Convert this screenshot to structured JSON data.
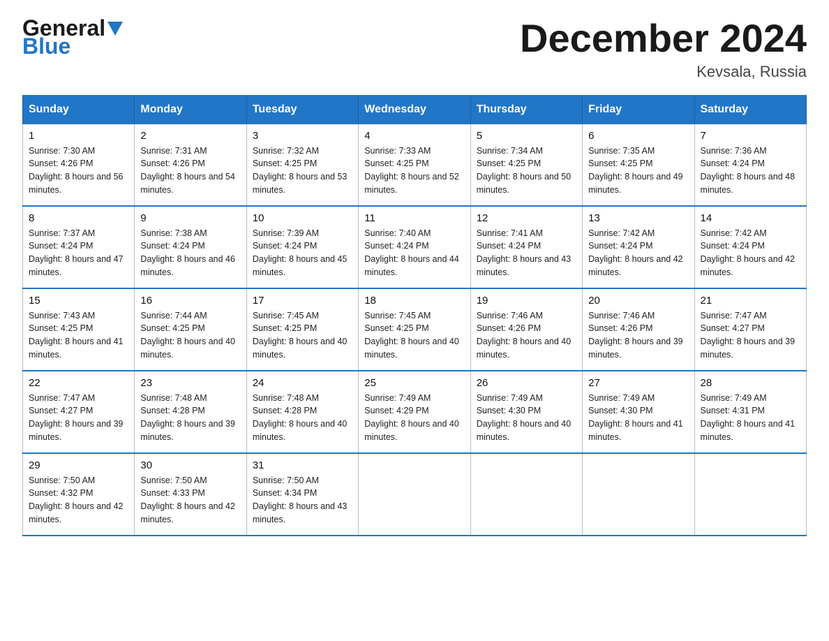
{
  "logo": {
    "line1": "General",
    "line2": "Blue"
  },
  "title": {
    "month_year": "December 2024",
    "location": "Kevsala, Russia"
  },
  "headers": [
    "Sunday",
    "Monday",
    "Tuesday",
    "Wednesday",
    "Thursday",
    "Friday",
    "Saturday"
  ],
  "weeks": [
    [
      {
        "day": "1",
        "sunrise": "7:30 AM",
        "sunset": "4:26 PM",
        "daylight": "8 hours and 56 minutes."
      },
      {
        "day": "2",
        "sunrise": "7:31 AM",
        "sunset": "4:26 PM",
        "daylight": "8 hours and 54 minutes."
      },
      {
        "day": "3",
        "sunrise": "7:32 AM",
        "sunset": "4:25 PM",
        "daylight": "8 hours and 53 minutes."
      },
      {
        "day": "4",
        "sunrise": "7:33 AM",
        "sunset": "4:25 PM",
        "daylight": "8 hours and 52 minutes."
      },
      {
        "day": "5",
        "sunrise": "7:34 AM",
        "sunset": "4:25 PM",
        "daylight": "8 hours and 50 minutes."
      },
      {
        "day": "6",
        "sunrise": "7:35 AM",
        "sunset": "4:25 PM",
        "daylight": "8 hours and 49 minutes."
      },
      {
        "day": "7",
        "sunrise": "7:36 AM",
        "sunset": "4:24 PM",
        "daylight": "8 hours and 48 minutes."
      }
    ],
    [
      {
        "day": "8",
        "sunrise": "7:37 AM",
        "sunset": "4:24 PM",
        "daylight": "8 hours and 47 minutes."
      },
      {
        "day": "9",
        "sunrise": "7:38 AM",
        "sunset": "4:24 PM",
        "daylight": "8 hours and 46 minutes."
      },
      {
        "day": "10",
        "sunrise": "7:39 AM",
        "sunset": "4:24 PM",
        "daylight": "8 hours and 45 minutes."
      },
      {
        "day": "11",
        "sunrise": "7:40 AM",
        "sunset": "4:24 PM",
        "daylight": "8 hours and 44 minutes."
      },
      {
        "day": "12",
        "sunrise": "7:41 AM",
        "sunset": "4:24 PM",
        "daylight": "8 hours and 43 minutes."
      },
      {
        "day": "13",
        "sunrise": "7:42 AM",
        "sunset": "4:24 PM",
        "daylight": "8 hours and 42 minutes."
      },
      {
        "day": "14",
        "sunrise": "7:42 AM",
        "sunset": "4:24 PM",
        "daylight": "8 hours and 42 minutes."
      }
    ],
    [
      {
        "day": "15",
        "sunrise": "7:43 AM",
        "sunset": "4:25 PM",
        "daylight": "8 hours and 41 minutes."
      },
      {
        "day": "16",
        "sunrise": "7:44 AM",
        "sunset": "4:25 PM",
        "daylight": "8 hours and 40 minutes."
      },
      {
        "day": "17",
        "sunrise": "7:45 AM",
        "sunset": "4:25 PM",
        "daylight": "8 hours and 40 minutes."
      },
      {
        "day": "18",
        "sunrise": "7:45 AM",
        "sunset": "4:25 PM",
        "daylight": "8 hours and 40 minutes."
      },
      {
        "day": "19",
        "sunrise": "7:46 AM",
        "sunset": "4:26 PM",
        "daylight": "8 hours and 40 minutes."
      },
      {
        "day": "20",
        "sunrise": "7:46 AM",
        "sunset": "4:26 PM",
        "daylight": "8 hours and 39 minutes."
      },
      {
        "day": "21",
        "sunrise": "7:47 AM",
        "sunset": "4:27 PM",
        "daylight": "8 hours and 39 minutes."
      }
    ],
    [
      {
        "day": "22",
        "sunrise": "7:47 AM",
        "sunset": "4:27 PM",
        "daylight": "8 hours and 39 minutes."
      },
      {
        "day": "23",
        "sunrise": "7:48 AM",
        "sunset": "4:28 PM",
        "daylight": "8 hours and 39 minutes."
      },
      {
        "day": "24",
        "sunrise": "7:48 AM",
        "sunset": "4:28 PM",
        "daylight": "8 hours and 40 minutes."
      },
      {
        "day": "25",
        "sunrise": "7:49 AM",
        "sunset": "4:29 PM",
        "daylight": "8 hours and 40 minutes."
      },
      {
        "day": "26",
        "sunrise": "7:49 AM",
        "sunset": "4:30 PM",
        "daylight": "8 hours and 40 minutes."
      },
      {
        "day": "27",
        "sunrise": "7:49 AM",
        "sunset": "4:30 PM",
        "daylight": "8 hours and 41 minutes."
      },
      {
        "day": "28",
        "sunrise": "7:49 AM",
        "sunset": "4:31 PM",
        "daylight": "8 hours and 41 minutes."
      }
    ],
    [
      {
        "day": "29",
        "sunrise": "7:50 AM",
        "sunset": "4:32 PM",
        "daylight": "8 hours and 42 minutes."
      },
      {
        "day": "30",
        "sunrise": "7:50 AM",
        "sunset": "4:33 PM",
        "daylight": "8 hours and 42 minutes."
      },
      {
        "day": "31",
        "sunrise": "7:50 AM",
        "sunset": "4:34 PM",
        "daylight": "8 hours and 43 minutes."
      },
      null,
      null,
      null,
      null
    ]
  ]
}
